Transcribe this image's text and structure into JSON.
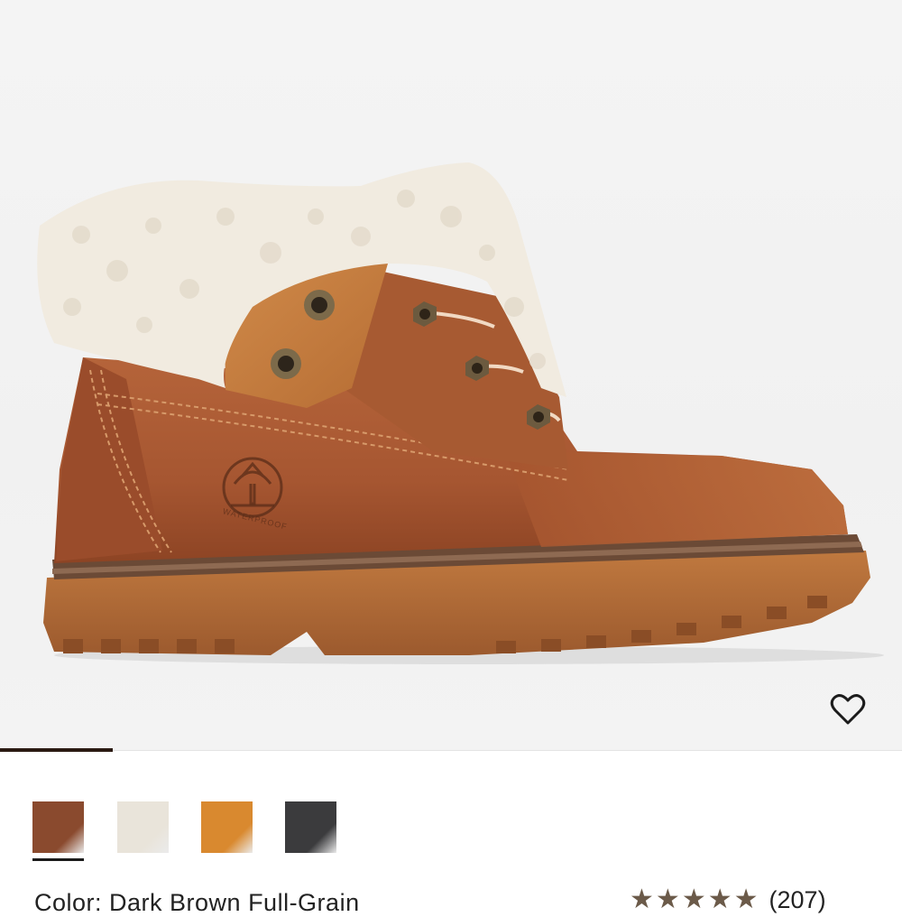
{
  "product": {
    "image_alt": "Timberland women's roll-top boot with fleece lining",
    "name": "Color: Dark Brown Full-Grain",
    "logo_text": "WATERPROOF"
  },
  "wishlist": {
    "icon": "heart-outline-icon"
  },
  "gallery": {
    "active_index": 0
  },
  "swatches": [
    {
      "label": "Dark Brown Full-Grain",
      "color": "#8a4a2e",
      "selected": true
    },
    {
      "label": "Cream",
      "color": "#e9e4da",
      "selected": false
    },
    {
      "label": "Wheat",
      "color": "#d9892f",
      "selected": false
    },
    {
      "label": "Black",
      "color": "#3b3b3d",
      "selected": false
    }
  ],
  "rating": {
    "stars": 5,
    "review_count": "(207)"
  },
  "colors": {
    "leather": "#a8582f",
    "fleece": "#f1ebe0",
    "sole": "#b56d3c"
  }
}
